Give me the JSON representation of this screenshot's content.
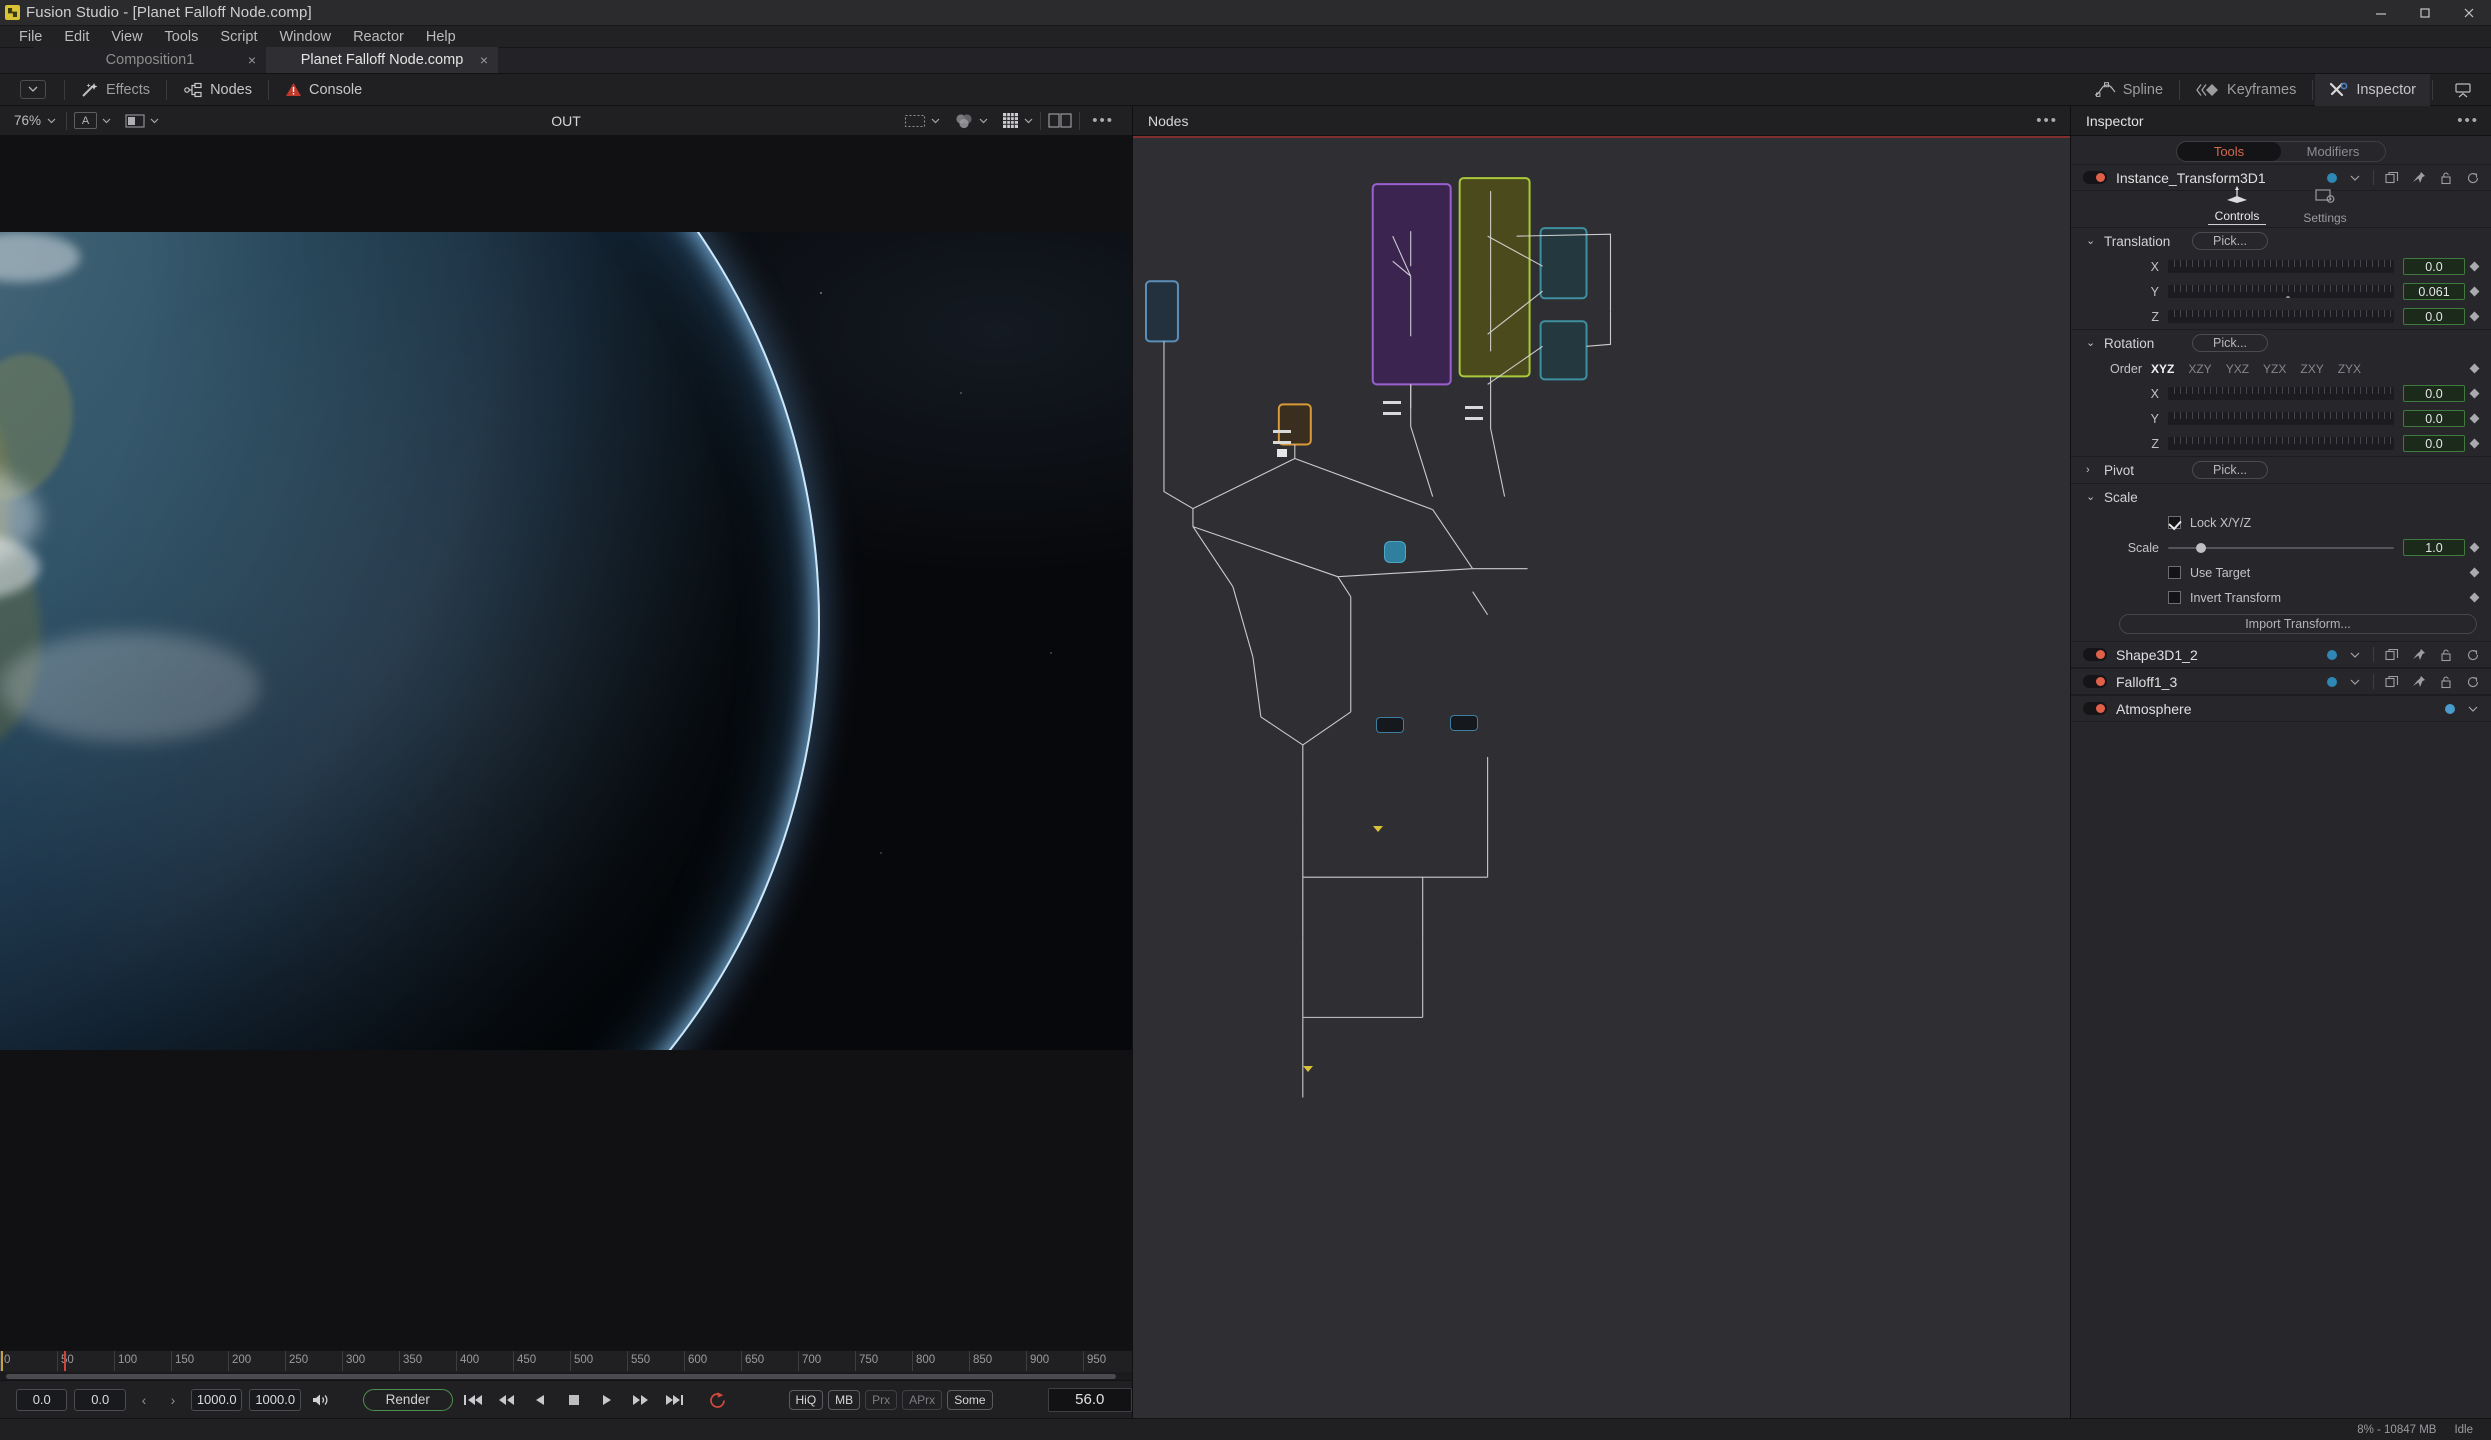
{
  "window": {
    "title": "Fusion Studio - [Planet Falloff Node.comp]",
    "app_icon": "fusion-logo-icon",
    "minimize": "minimize-icon",
    "maximize": "maximize-icon",
    "close": "close-icon"
  },
  "menubar": {
    "items": [
      "File",
      "Edit",
      "View",
      "Tools",
      "Script",
      "Window",
      "Reactor",
      "Help"
    ]
  },
  "tabs": [
    {
      "label": "Composition1",
      "active": false,
      "close": "×"
    },
    {
      "label": "Planet Falloff Node.comp",
      "active": true,
      "close": "×"
    }
  ],
  "toolbar": {
    "left": [
      {
        "label": "Effects",
        "icon": "magic-wand-icon",
        "active": false
      },
      {
        "label": "Nodes",
        "icon": "nodes-graph-icon",
        "active": true
      },
      {
        "label": "Console",
        "icon": "warning-triangle-icon",
        "active": false
      }
    ],
    "right": [
      {
        "label": "Spline",
        "icon": "spline-curve-icon",
        "active": false
      },
      {
        "label": "Keyframes",
        "icon": "keyframes-icon",
        "active": false
      },
      {
        "label": "Inspector",
        "icon": "inspector-wrench-icon",
        "active": true
      }
    ],
    "panel_toggle_icon": "panel-layout-icon"
  },
  "viewer": {
    "zoom": "76%",
    "title": "OUT",
    "chip_a": "A",
    "icons": {
      "split_view": "split-view-icon",
      "roi": "region-of-interest-icon",
      "color": "color-wheels-icon",
      "grid": "grid-icon",
      "panes": "dual-pane-icon",
      "more": "more-options-icon"
    },
    "image_description": "Earth from orbit with blue atmospheric rim light"
  },
  "timeline": {
    "ticks": [
      "0",
      "50",
      "100",
      "150",
      "200",
      "250",
      "300",
      "350",
      "400",
      "450",
      "500",
      "550",
      "600",
      "650",
      "700",
      "750",
      "800",
      "850",
      "900",
      "950"
    ],
    "playhead_frame": 56
  },
  "transport": {
    "render_start": "0.0",
    "current_start": "0.0",
    "prev_icon": "‹",
    "next_icon": "›",
    "render_end": "1000.0",
    "global_end": "1000.0",
    "audio_icon": "speaker-icon",
    "render_label": "Render",
    "buttons": [
      {
        "name": "first-frame-button",
        "icon": "skip-to-start-icon"
      },
      {
        "name": "fast-reverse-button",
        "icon": "rewind-icon"
      },
      {
        "name": "play-reverse-button",
        "icon": "play-reverse-icon"
      },
      {
        "name": "stop-button",
        "icon": "stop-icon"
      },
      {
        "name": "play-button",
        "icon": "play-icon"
      },
      {
        "name": "fast-forward-button",
        "icon": "fast-forward-icon"
      },
      {
        "name": "last-frame-button",
        "icon": "skip-to-end-icon"
      },
      {
        "name": "loop-button",
        "icon": "loop-icon"
      }
    ],
    "quality": [
      {
        "label": "HiQ",
        "on": true
      },
      {
        "label": "MB",
        "on": true
      },
      {
        "label": "Prx",
        "on": false
      },
      {
        "label": "APrx",
        "on": false
      },
      {
        "label": "Some",
        "on": true
      }
    ],
    "current_time": "56.0"
  },
  "nodes_panel": {
    "title": "Nodes",
    "more_icon": "more-options-icon"
  },
  "inspector": {
    "title": "Inspector",
    "more_icon": "more-options-icon",
    "tabs": [
      {
        "label": "Tools",
        "selected": true
      },
      {
        "label": "Modifiers",
        "selected": false
      }
    ],
    "active_node": {
      "name": "Instance_Transform3D1",
      "enable_toggle": "red",
      "dot_color": "#2f87b5",
      "icons": [
        "duplicate-icon",
        "pin-icon",
        "lock-icon",
        "reset-icon"
      ]
    },
    "control_tabs": [
      {
        "label": "Controls",
        "icon": "transform-axis-icon",
        "selected": true
      },
      {
        "label": "Settings",
        "icon": "settings-gear-icon",
        "selected": false
      }
    ],
    "sections": {
      "translation": {
        "title": "Translation",
        "expanded": true,
        "pick_label": "Pick...",
        "rows": [
          {
            "label": "X",
            "value": "0.0",
            "knob_pct": 0
          },
          {
            "label": "Y",
            "value": "0.061",
            "knob_pct": 52
          },
          {
            "label": "Z",
            "value": "0.0",
            "knob_pct": 0
          }
        ]
      },
      "rotation": {
        "title": "Rotation",
        "expanded": true,
        "pick_label": "Pick...",
        "order_label": "Order",
        "order_options": [
          "XYZ",
          "XZY",
          "YXZ",
          "YZX",
          "ZXY",
          "ZYX"
        ],
        "order_selected": "XYZ",
        "rows": [
          {
            "label": "X",
            "value": "0.0"
          },
          {
            "label": "Y",
            "value": "0.0"
          },
          {
            "label": "Z",
            "value": "0.0"
          }
        ]
      },
      "pivot": {
        "title": "Pivot",
        "expanded": false,
        "pick_label": "Pick..."
      },
      "scale": {
        "title": "Scale",
        "expanded": true,
        "lock_label": "Lock X/Y/Z",
        "lock_checked": true,
        "scale_label": "Scale",
        "scale_value": "1.0"
      },
      "options": {
        "use_target_label": "Use Target",
        "use_target_checked": false,
        "invert_label": "Invert Transform",
        "invert_checked": false,
        "import_label": "Import Transform..."
      }
    },
    "node_list": [
      {
        "name": "Shape3D1_2",
        "full_icons": true
      },
      {
        "name": "Falloff1_3",
        "full_icons": true
      },
      {
        "name": "Atmosphere",
        "full_icons": false
      }
    ]
  },
  "statusbar": {
    "memory": "8% - 10847 MB",
    "state": "Idle"
  }
}
